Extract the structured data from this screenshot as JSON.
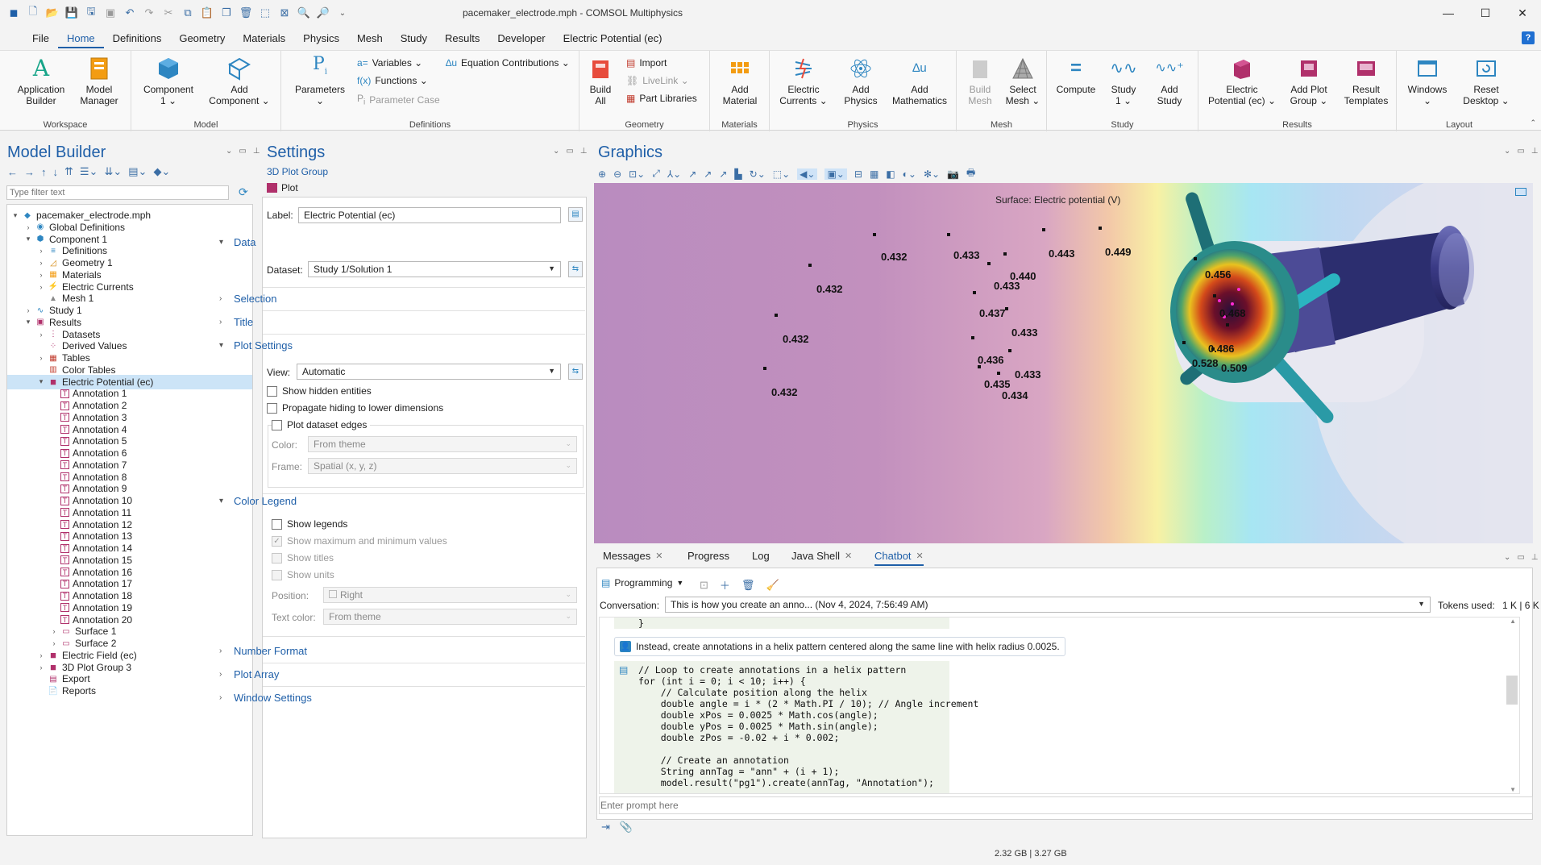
{
  "window": {
    "title": "pacemaker_electrode.mph - COMSOL Multiphysics",
    "controls": [
      "minimize-icon",
      "maximize-icon",
      "close-icon"
    ]
  },
  "menu": {
    "items": [
      "File",
      "Home",
      "Definitions",
      "Geometry",
      "Materials",
      "Physics",
      "Mesh",
      "Study",
      "Results",
      "Developer",
      "Electric Potential (ec)"
    ],
    "active": "Home",
    "help": "?"
  },
  "ribbon": {
    "groups": {
      "workspace": "Workspace",
      "model": "Model",
      "definitions": "Definitions",
      "geometry": "Geometry",
      "materials": "Materials",
      "physics": "Physics",
      "mesh": "Mesh",
      "study": "Study",
      "results": "Results",
      "layout": "Layout"
    },
    "buttons": {
      "application_builder": [
        "Application",
        "Builder"
      ],
      "model_manager": [
        "Model",
        "Manager"
      ],
      "component": [
        "Component",
        "1 ⌄"
      ],
      "add_component": [
        "Add",
        "Component ⌄"
      ],
      "parameters": [
        "Parameters",
        "⌄"
      ],
      "variables": "Variables ⌄",
      "functions": "Functions ⌄",
      "parameter_case": "Parameter Case",
      "equation_contributions": "Equation Contributions ⌄",
      "build_all": [
        "Build",
        "All"
      ],
      "import": "Import",
      "livelink": "LiveLink ⌄",
      "part_libraries": "Part Libraries",
      "add_material": [
        "Add",
        "Material"
      ],
      "electric_currents": [
        "Electric",
        "Currents ⌄"
      ],
      "add_physics": [
        "Add",
        "Physics"
      ],
      "add_mathematics": [
        "Add",
        "Mathematics"
      ],
      "build_mesh": [
        "Build",
        "Mesh"
      ],
      "select_mesh": [
        "Select",
        "Mesh ⌄"
      ],
      "compute": "Compute",
      "study_1": [
        "Study",
        "1 ⌄"
      ],
      "add_study": [
        "Add",
        "Study"
      ],
      "electric_potential": [
        "Electric",
        "Potential (ec) ⌄"
      ],
      "add_plot_group": [
        "Add Plot",
        "Group ⌄"
      ],
      "result_templates": [
        "Result",
        "Templates"
      ],
      "windows": [
        "Windows",
        "⌄"
      ],
      "reset_desktop": [
        "Reset",
        "Desktop ⌄"
      ]
    }
  },
  "model_builder": {
    "title": "Model Builder",
    "filter_placeholder": "Type filter text",
    "tree": [
      {
        "label": "pacemaker_electrode.mph",
        "depth": 0,
        "arrow": "▾",
        "icon": "model-file-icon"
      },
      {
        "label": "Global Definitions",
        "depth": 1,
        "arrow": "›",
        "icon": "globe-icon"
      },
      {
        "label": "Component 1",
        "depth": 1,
        "arrow": "▾",
        "icon": "component-icon"
      },
      {
        "label": "Definitions",
        "depth": 2,
        "arrow": "›",
        "icon": "definitions-icon"
      },
      {
        "label": "Geometry 1",
        "depth": 2,
        "arrow": "›",
        "icon": "geometry-icon"
      },
      {
        "label": "Materials",
        "depth": 2,
        "arrow": "›",
        "icon": "materials-icon"
      },
      {
        "label": "Electric Currents",
        "depth": 2,
        "arrow": "›",
        "icon": "electric-currents-icon"
      },
      {
        "label": "Mesh 1",
        "depth": 2,
        "arrow": "",
        "icon": "mesh-icon"
      },
      {
        "label": "Study 1",
        "depth": 1,
        "arrow": "›",
        "icon": "study-icon"
      },
      {
        "label": "Results",
        "depth": 1,
        "arrow": "▾",
        "icon": "results-icon"
      },
      {
        "label": "Datasets",
        "depth": 2,
        "arrow": "›",
        "icon": "datasets-icon"
      },
      {
        "label": "Derived Values",
        "depth": 2,
        "arrow": "",
        "icon": "derived-values-icon"
      },
      {
        "label": "Tables",
        "depth": 2,
        "arrow": "›",
        "icon": "tables-icon"
      },
      {
        "label": "Color Tables",
        "depth": 2,
        "arrow": "",
        "icon": "color-tables-icon"
      },
      {
        "label": "Electric Potential (ec)",
        "depth": 2,
        "arrow": "▾",
        "icon": "plot-group-icon",
        "selected": true
      },
      {
        "label": "Annotation 1",
        "depth": 3,
        "arrow": "",
        "icon": "annotation-icon"
      },
      {
        "label": "Annotation 2",
        "depth": 3,
        "arrow": "",
        "icon": "annotation-icon"
      },
      {
        "label": "Annotation 3",
        "depth": 3,
        "arrow": "",
        "icon": "annotation-icon"
      },
      {
        "label": "Annotation 4",
        "depth": 3,
        "arrow": "",
        "icon": "annotation-icon"
      },
      {
        "label": "Annotation 5",
        "depth": 3,
        "arrow": "",
        "icon": "annotation-icon"
      },
      {
        "label": "Annotation 6",
        "depth": 3,
        "arrow": "",
        "icon": "annotation-icon"
      },
      {
        "label": "Annotation 7",
        "depth": 3,
        "arrow": "",
        "icon": "annotation-icon"
      },
      {
        "label": "Annotation 8",
        "depth": 3,
        "arrow": "",
        "icon": "annotation-icon"
      },
      {
        "label": "Annotation 9",
        "depth": 3,
        "arrow": "",
        "icon": "annotation-icon"
      },
      {
        "label": "Annotation 10",
        "depth": 3,
        "arrow": "",
        "icon": "annotation-icon"
      },
      {
        "label": "Annotation 11",
        "depth": 3,
        "arrow": "",
        "icon": "annotation-icon"
      },
      {
        "label": "Annotation 12",
        "depth": 3,
        "arrow": "",
        "icon": "annotation-icon"
      },
      {
        "label": "Annotation 13",
        "depth": 3,
        "arrow": "",
        "icon": "annotation-icon"
      },
      {
        "label": "Annotation 14",
        "depth": 3,
        "arrow": "",
        "icon": "annotation-icon"
      },
      {
        "label": "Annotation 15",
        "depth": 3,
        "arrow": "",
        "icon": "annotation-icon"
      },
      {
        "label": "Annotation 16",
        "depth": 3,
        "arrow": "",
        "icon": "annotation-icon"
      },
      {
        "label": "Annotation 17",
        "depth": 3,
        "arrow": "",
        "icon": "annotation-icon"
      },
      {
        "label": "Annotation 18",
        "depth": 3,
        "arrow": "",
        "icon": "annotation-icon"
      },
      {
        "label": "Annotation 19",
        "depth": 3,
        "arrow": "",
        "icon": "annotation-icon"
      },
      {
        "label": "Annotation 20",
        "depth": 3,
        "arrow": "",
        "icon": "annotation-icon"
      },
      {
        "label": "Surface 1",
        "depth": 3,
        "arrow": "›",
        "icon": "surface-icon"
      },
      {
        "label": "Surface 2",
        "depth": 3,
        "arrow": "›",
        "icon": "surface-icon"
      },
      {
        "label": "Electric Field (ec)",
        "depth": 2,
        "arrow": "›",
        "icon": "plot-group-icon"
      },
      {
        "label": "3D Plot Group 3",
        "depth": 2,
        "arrow": "›",
        "icon": "plot-group-icon"
      },
      {
        "label": "Export",
        "depth": 2,
        "arrow": "",
        "icon": "export-icon"
      },
      {
        "label": "Reports",
        "depth": 2,
        "arrow": "",
        "icon": "reports-icon"
      }
    ]
  },
  "settings": {
    "title": "Settings",
    "subtitle": "3D Plot Group",
    "plot_button": "Plot",
    "label_caption": "Label:",
    "label_value": "Electric Potential (ec)",
    "sections": {
      "data": "Data",
      "selection": "Selection",
      "title": "Title",
      "plot_settings": "Plot Settings",
      "color_legend": "Color Legend",
      "number_format": "Number Format",
      "plot_array": "Plot Array",
      "window_settings": "Window Settings"
    },
    "dataset_caption": "Dataset:",
    "dataset_value": "Study 1/Solution 1",
    "view_caption": "View:",
    "view_value": "Automatic",
    "show_hidden_entities": "Show hidden entities",
    "propagate_hiding": "Propagate hiding to lower dimensions",
    "plot_dataset_edges": "Plot dataset edges",
    "color_caption": "Color:",
    "color_value": "From theme",
    "frame_caption": "Frame:",
    "frame_value": "Spatial  (x, y, z)",
    "show_legends": "Show legends",
    "show_max_min": "Show maximum and minimum values",
    "show_titles": "Show titles",
    "show_units": "Show units",
    "position_caption": "Position:",
    "position_value": "Right",
    "text_color_caption": "Text color:",
    "text_color_value": "From theme"
  },
  "graphics": {
    "title": "Graphics",
    "surface_title": "Surface: Electric potential (V)",
    "annotations": [
      "0.432",
      "0.433",
      "0.432",
      "0.432",
      "0.432",
      "0.443",
      "0.449",
      "0.440",
      "0.433",
      "0.437",
      "0.433",
      "0.436",
      "0.433",
      "0.435",
      "0.434",
      "0.456",
      "0.468",
      "0.486",
      "0.528",
      "0.509"
    ]
  },
  "bottom": {
    "tabs": [
      "Messages",
      "Progress",
      "Log",
      "Java Shell",
      "Chatbot"
    ],
    "active_tab": "Chatbot",
    "mode": "Programming",
    "conversation_caption": "Conversation:",
    "conversation_value": "This is how you create an anno... (Nov 4, 2024, 7:56:49 AM)",
    "tokens_caption": "Tokens used:",
    "tokens_value": "1 K | 6 K",
    "code_top": "}",
    "user_message": "Instead, create annotations in a helix pattern centered along the same line with helix radius 0.0025.",
    "code_lines": [
      "// Loop to create annotations in a helix pattern",
      "for (int i = 0; i < 10; i++) {",
      "    // Calculate position along the helix",
      "    double angle = i * (2 * Math.PI / 10); // Angle increment",
      "    double xPos = 0.0025 * Math.cos(angle);",
      "    double yPos = 0.0025 * Math.sin(angle);",
      "    double zPos = -0.02 + i * 0.002;",
      "",
      "    // Create an annotation",
      "    String annTag = \"ann\" + (i + 1);",
      "    model.result(\"pg1\").create(annTag, \"Annotation\");"
    ],
    "prompt_placeholder": "Enter prompt here"
  },
  "status": {
    "memory": "2.32 GB | 3.27 GB"
  },
  "colors": {
    "accent": "#1f5fa8",
    "selection": "#cce4f7",
    "annotation_icon": "#b0306b"
  }
}
